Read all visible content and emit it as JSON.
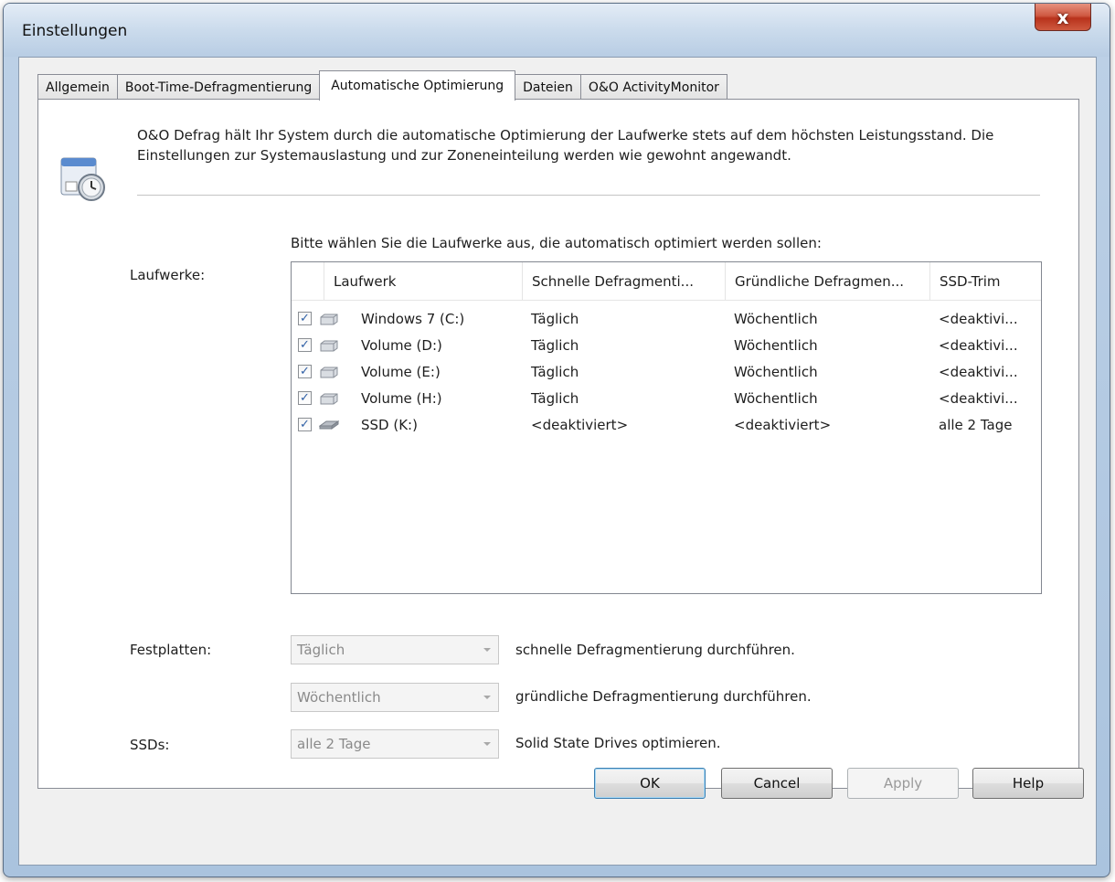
{
  "window": {
    "title": "Einstellungen",
    "close_symbol": "x"
  },
  "tabs": [
    {
      "label": "Allgemein"
    },
    {
      "label": "Boot-Time-Defragmentierung"
    },
    {
      "label": "Automatische Optimierung",
      "active": true
    },
    {
      "label": "Dateien"
    },
    {
      "label": "O&O ActivityMonitor"
    }
  ],
  "intro": {
    "text": "O&O Defrag hält Ihr System durch die automatische Optimierung der Laufwerke stets auf dem höchsten Leistungsstand. Die Einstellungen zur Systemauslastung und zur Zoneneinteilung werden wie gewohnt angewandt."
  },
  "drives": {
    "prompt": "Bitte wählen Sie die Laufwerke aus, die automatisch optimiert werden sollen:",
    "label": "Laufwerke:",
    "columns": [
      "Laufwerk",
      "Schnelle Defragmenti...",
      "Gründliche Defragmen...",
      "SSD-Trim"
    ],
    "rows": [
      {
        "checked": true,
        "name": "Windows 7 (C:)",
        "quick": "Täglich",
        "thorough": "Wöchentlich",
        "trim": "<deaktivi...",
        "icon": "hdd-icon"
      },
      {
        "checked": true,
        "name": "Volume (D:)",
        "quick": "Täglich",
        "thorough": "Wöchentlich",
        "trim": "<deaktivi...",
        "icon": "hdd-icon"
      },
      {
        "checked": true,
        "name": "Volume (E:)",
        "quick": "Täglich",
        "thorough": "Wöchentlich",
        "trim": "<deaktivi...",
        "icon": "hdd-icon"
      },
      {
        "checked": true,
        "name": "Volume (H:)",
        "quick": "Täglich",
        "thorough": "Wöchentlich",
        "trim": "<deaktivi...",
        "icon": "hdd-icon"
      },
      {
        "checked": true,
        "name": "SSD (K:)",
        "quick": "<deaktiviert>",
        "thorough": "<deaktiviert>",
        "trim": "alle 2 Tage",
        "icon": "ssd-icon"
      }
    ]
  },
  "settings": {
    "hdd_label": "Festplatten:",
    "quick_value": "Täglich",
    "quick_desc": "schnelle Defragmentierung durchführen.",
    "thorough_value": "Wöchentlich",
    "thorough_desc": "gründliche Defragmentierung durchführen.",
    "ssd_label": "SSDs:",
    "ssd_value": "alle 2 Tage",
    "ssd_desc": "Solid State Drives optimieren."
  },
  "buttons": {
    "ok": "OK",
    "cancel": "Cancel",
    "apply": "Apply",
    "help": "Help"
  },
  "colors": {
    "accent": "#3c7fb1",
    "close": "#c94a33",
    "check": "#2f5fa5"
  }
}
